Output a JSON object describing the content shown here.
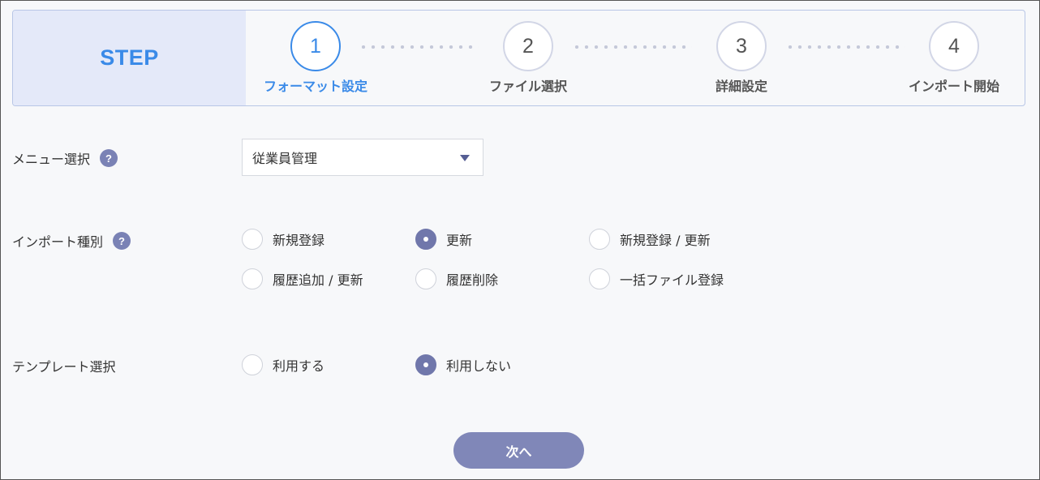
{
  "stepper": {
    "title": "STEP",
    "steps": [
      {
        "number": "1",
        "label": "フォーマット設定",
        "active": true
      },
      {
        "number": "2",
        "label": "ファイル選択",
        "active": false
      },
      {
        "number": "3",
        "label": "詳細設定",
        "active": false
      },
      {
        "number": "4",
        "label": "インポート開始",
        "active": false
      }
    ]
  },
  "menu_select": {
    "label": "メニュー選択",
    "help": "?",
    "value": "従業員管理"
  },
  "import_type": {
    "label": "インポート種別",
    "help": "?",
    "options": [
      {
        "label": "新規登録",
        "checked": false
      },
      {
        "label": "更新",
        "checked": true
      },
      {
        "label": "新規登録 / 更新",
        "checked": false
      },
      {
        "label": "履歴追加 / 更新",
        "checked": false
      },
      {
        "label": "履歴削除",
        "checked": false
      },
      {
        "label": "一括ファイル登録",
        "checked": false
      }
    ]
  },
  "template_select": {
    "label": "テンプレート選択",
    "options": [
      {
        "label": "利用する",
        "checked": false
      },
      {
        "label": "利用しない",
        "checked": true
      }
    ]
  },
  "next_button": {
    "label": "次へ"
  },
  "colors": {
    "accent_blue": "#3a8ae8",
    "radio_selected": "#7077ab",
    "button_bg": "#8087b8"
  }
}
